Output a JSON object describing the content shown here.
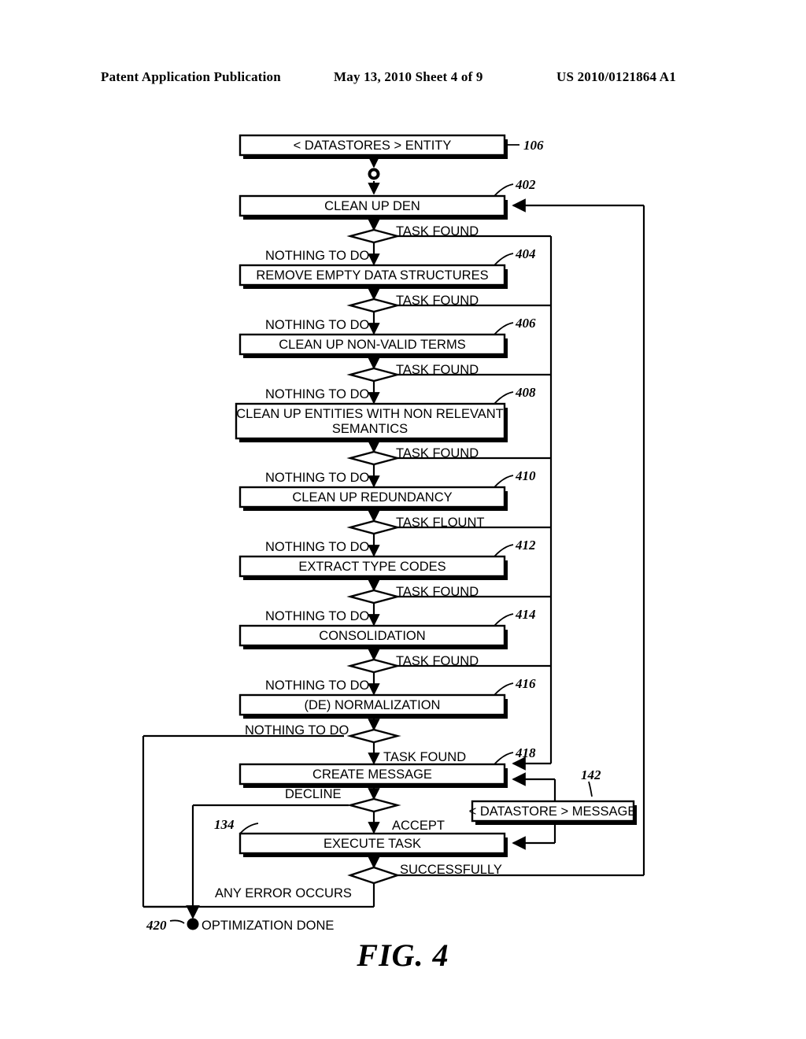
{
  "header": {
    "publication": "Patent Application Publication",
    "date_sheet": "May 13, 2010  Sheet 4 of 9",
    "patent_number": "US 2010/0121864 A1"
  },
  "figure": {
    "caption": "FIG. 4",
    "title": "Optimization process flow"
  },
  "nodes": {
    "datastores_entity": {
      "label": "< DATASTORES > ENTITY",
      "ref": "106"
    },
    "start_node": {
      "label": "start-node",
      "ref": ""
    },
    "clean_up_den": {
      "label": "CLEAN UP DEN",
      "ref": "402"
    },
    "remove_empty": {
      "label": "REMOVE EMPTY DATA STRUCTURES",
      "ref": "404"
    },
    "clean_non_valid": {
      "label": "CLEAN UP NON-VALID TERMS",
      "ref": "406"
    },
    "clean_entities_1": {
      "label": "CLEAN UP ENTITIES WITH NON RELEVANT",
      "label2": "SEMANTICS",
      "ref": "408"
    },
    "clean_redundancy": {
      "label": "CLEAN UP REDUNDANCY",
      "ref": "410"
    },
    "extract_type_codes": {
      "label": "EXTRACT TYPE CODES",
      "ref": "412"
    },
    "consolidation": {
      "label": "CONSOLIDATION",
      "ref": "414"
    },
    "de_normalization": {
      "label": "(DE) NORMALIZATION",
      "ref": "416"
    },
    "create_message": {
      "label": "CREATE MESSAGE",
      "ref": "418"
    },
    "execute_task": {
      "label": "EXECUTE TASK",
      "ref": "134"
    },
    "datastore_message": {
      "label": "< DATASTORE > MESSAGE",
      "ref": "142"
    },
    "optimization_done": {
      "label": "OPTIMIZATION DONE",
      "ref": "420"
    }
  },
  "edge_labels": {
    "task_found_1": "TASK FOUND",
    "task_found_2": "TASK FOUND",
    "task_found_3": "TASK FOUND",
    "task_found_4": "TASK FOUND",
    "task_flount": "TASK FLOUNT",
    "task_found_6": "TASK FOUND",
    "task_found_7": "TASK FOUND",
    "task_found_8": "TASK FOUND",
    "nothing_to_do_1": "NOTHING TO DO",
    "nothing_to_do_2": "NOTHING TO DO",
    "nothing_to_do_3": "NOTHING TO DO",
    "nothing_to_do_4": "NOTHING TO DO",
    "nothing_to_do_5": "NOTHING TO DO",
    "nothing_to_do_6": "NOTHING TO DO",
    "nothing_to_do_7": "NOTHING TO DO",
    "nothing_to_do_8": "NOTHING TO DO",
    "decline": "DECLINE",
    "accept": "ACCEPT",
    "successfully": "SUCCESSFULLY",
    "any_error_occurs": "ANY ERROR OCCURS"
  },
  "colors": {
    "ink": "#000000",
    "paper": "#ffffff"
  }
}
